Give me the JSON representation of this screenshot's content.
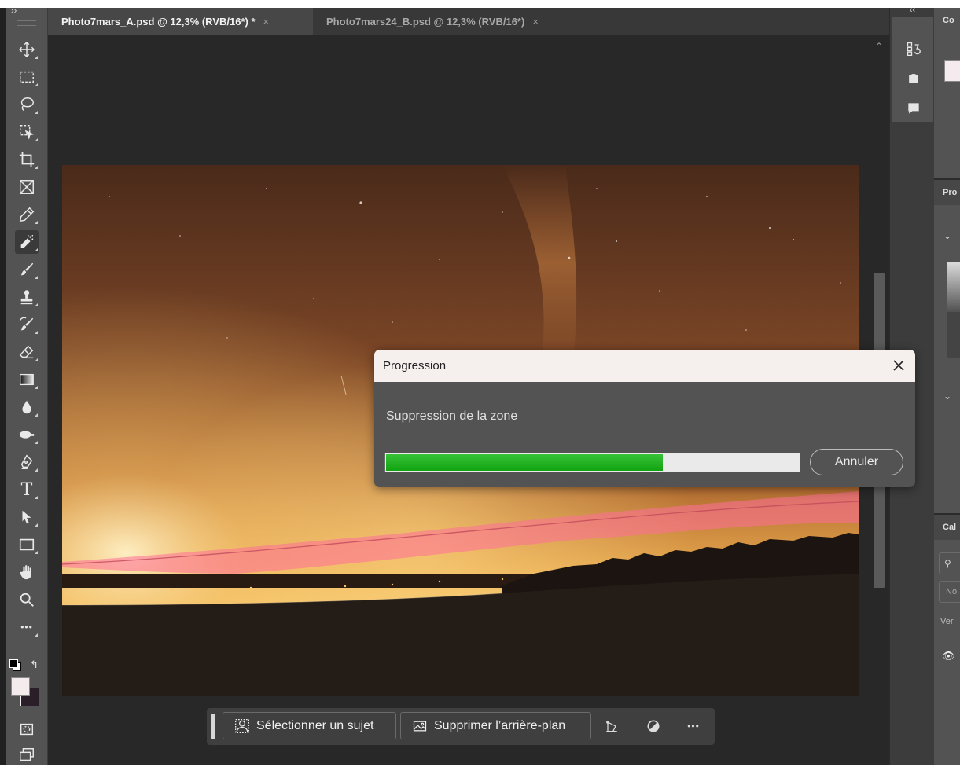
{
  "tabs": [
    {
      "title": "Photo7mars_A.psd @ 12,3% (RVB/16*) *",
      "close": "×"
    },
    {
      "title": "Photo7mars24_B.psd @ 12,3% (RVB/16*)",
      "close": "×"
    }
  ],
  "toolbar": {
    "expand": "››",
    "tools": [
      "move-tool",
      "marquee-tool",
      "lasso-tool",
      "object-selection-tool",
      "crop-tool",
      "frame-tool",
      "eyedropper-tool",
      "remove-tool",
      "brush-tool",
      "stamp-tool",
      "history-brush-tool",
      "eraser-tool",
      "gradient-tool",
      "blur-tool",
      "dodge-tool",
      "pen-tool",
      "type-tool",
      "path-selection-tool",
      "rectangle-tool",
      "hand-tool",
      "zoom-tool",
      "more-tools"
    ],
    "active_tool": "remove-tool",
    "type_tool_glyph": "T",
    "more_glyph": "•••",
    "foreground_color": "#f4ecec",
    "background_color": "#2a1e28"
  },
  "dock": {
    "collapse": "‹‹",
    "icons": [
      "history-icon",
      "libraries-icon",
      "comments-icon"
    ]
  },
  "right_panels": {
    "color_head": "Co",
    "properties_head": "Pro",
    "layers_head": "Cal",
    "layers_filter": "No",
    "layers_lock": "Ver"
  },
  "dialog": {
    "title": "Progression",
    "close": "close",
    "message": "Suppression de la zone",
    "progress": 0.67,
    "cancel_label": "Annuler"
  },
  "taskbar": {
    "select_subject": "Sélectionner un sujet",
    "remove_background": "Supprimer l’arrière-plan",
    "more": "•••"
  },
  "colors": {
    "accent_progress": "#1fae1f",
    "mask_overlay": "#ff6e9a"
  }
}
